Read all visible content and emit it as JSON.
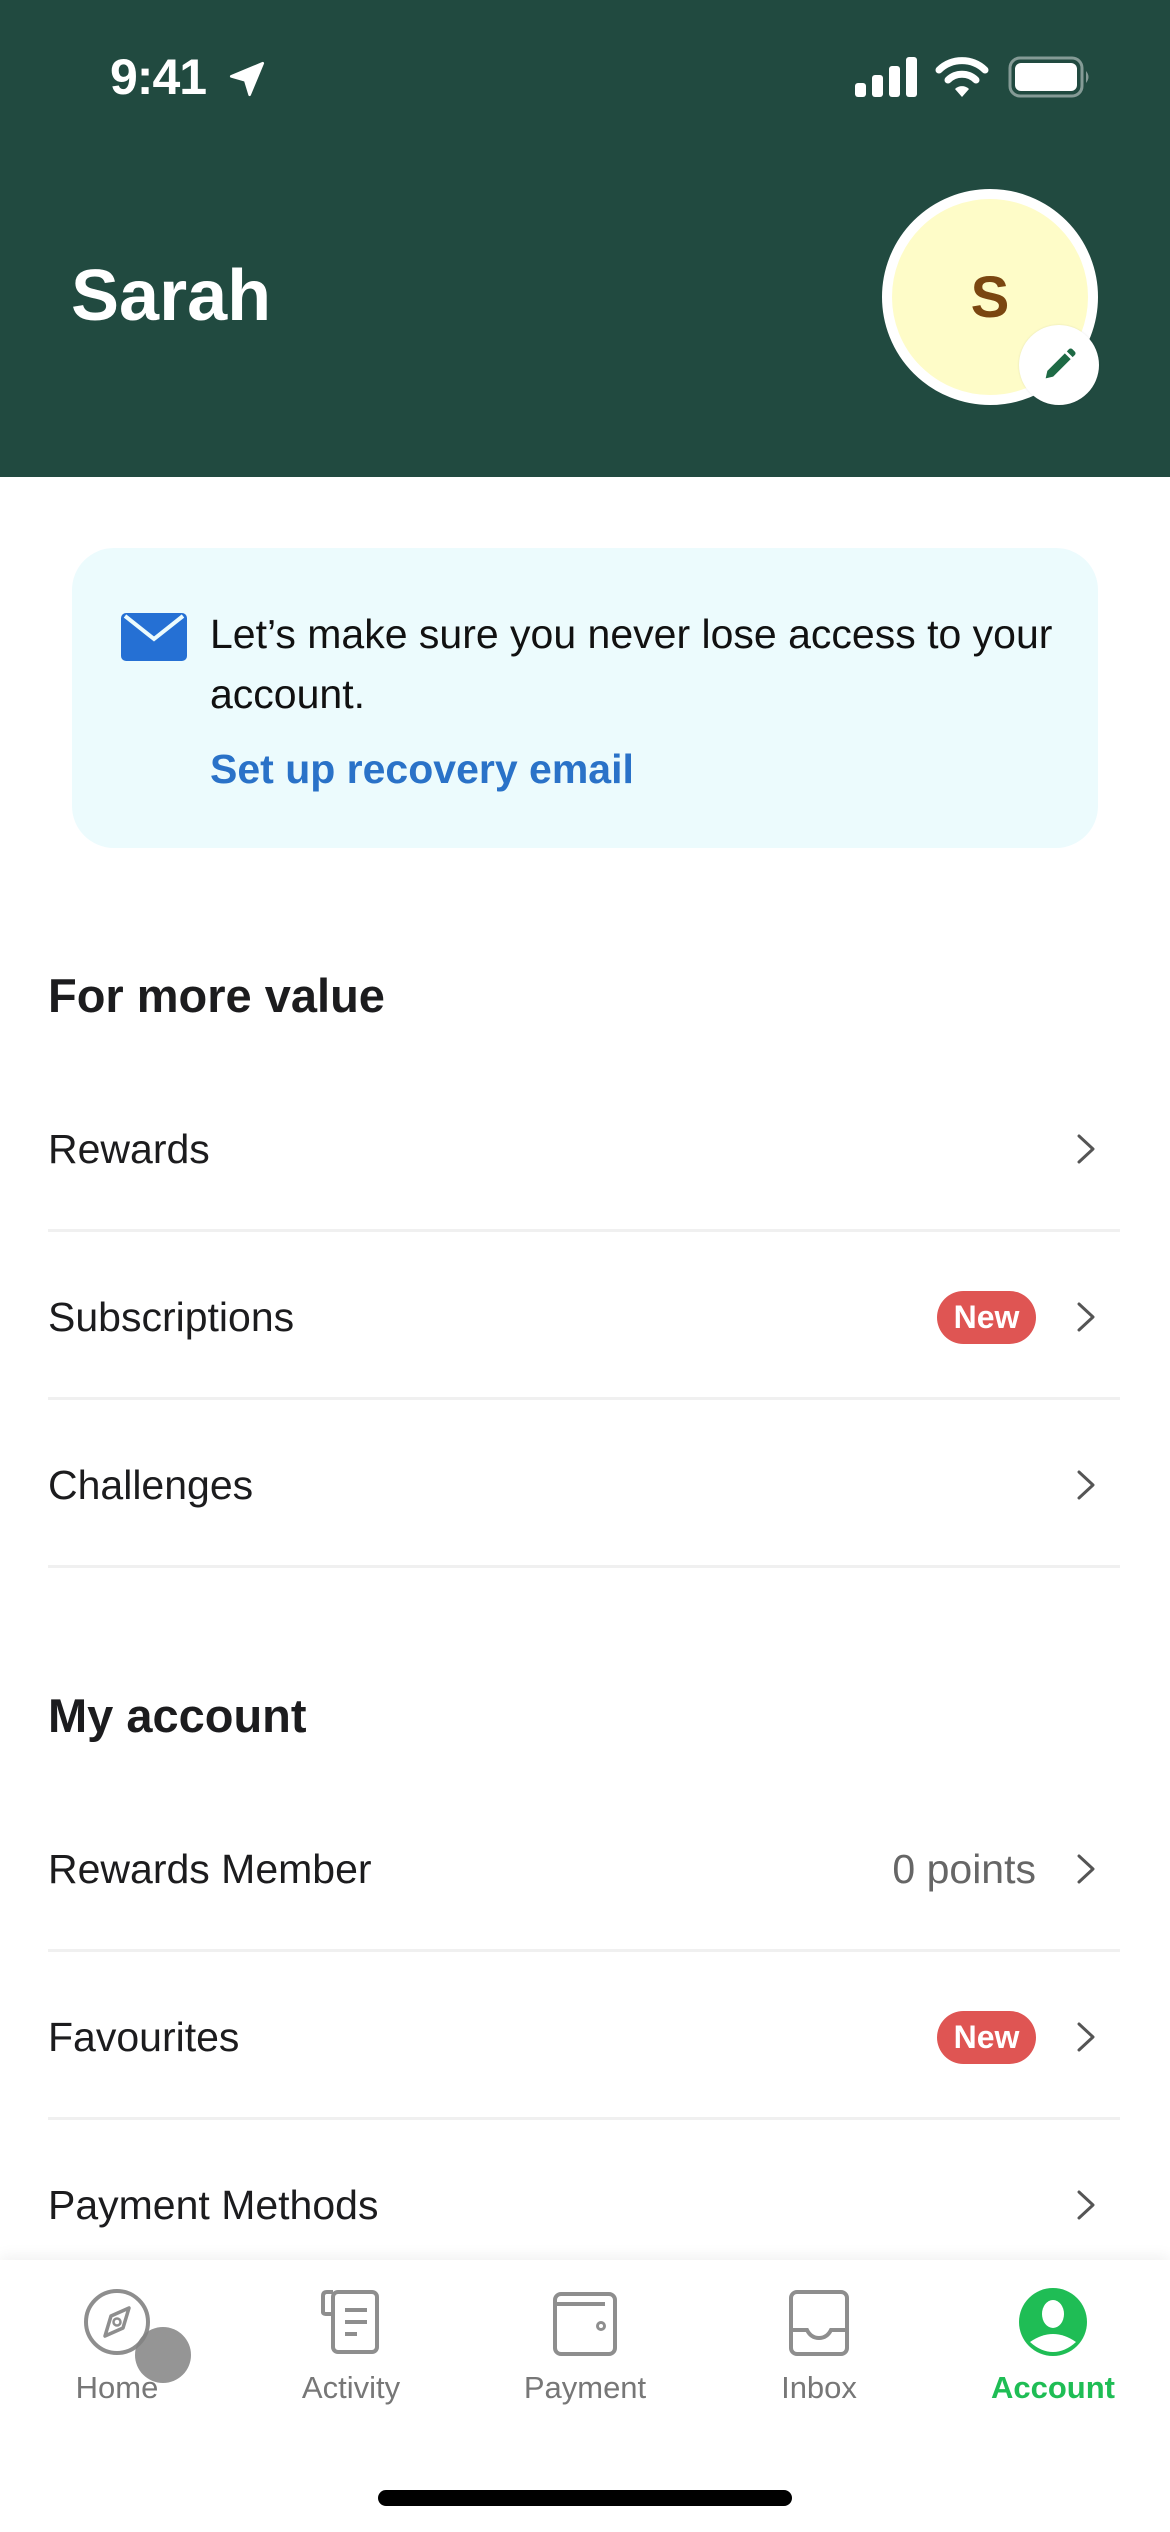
{
  "status_bar": {
    "time": "9:41",
    "icons": [
      "location-arrow-icon",
      "signal-icon",
      "wifi-icon",
      "battery-icon"
    ]
  },
  "header": {
    "user_name": "Sarah",
    "avatar_initial": "S",
    "edit_icon": "pencil-icon"
  },
  "recovery_card": {
    "icon": "mail-icon",
    "message": "Let’s make sure you never lose access to your account.",
    "link_label": "Set up recovery email"
  },
  "sections": [
    {
      "title": "For more value",
      "items": [
        {
          "label": "Rewards",
          "value": null,
          "badge": null
        },
        {
          "label": "Subscriptions",
          "value": null,
          "badge": "New"
        },
        {
          "label": "Challenges",
          "value": null,
          "badge": null
        }
      ]
    },
    {
      "title": "My account",
      "items": [
        {
          "label": "Rewards Member",
          "value": "0 points",
          "badge": null
        },
        {
          "label": "Favourites",
          "value": null,
          "badge": "New"
        },
        {
          "label": "Payment Methods",
          "value": null,
          "badge": null
        }
      ]
    }
  ],
  "tabbar": {
    "active": "Account",
    "tabs": [
      {
        "label": "Home",
        "icon": "compass-icon"
      },
      {
        "label": "Activity",
        "icon": "receipt-icon"
      },
      {
        "label": "Payment",
        "icon": "wallet-icon"
      },
      {
        "label": "Inbox",
        "icon": "inbox-icon"
      },
      {
        "label": "Account",
        "icon": "account-icon"
      }
    ]
  },
  "colors": {
    "header_bg": "#214a40",
    "avatar_bg": "#fefcc8",
    "avatar_text": "#7a4610",
    "card_bg": "#ecfbfd",
    "link": "#2a72c8",
    "badge": "#df5553",
    "active_tab": "#1fbd55"
  }
}
